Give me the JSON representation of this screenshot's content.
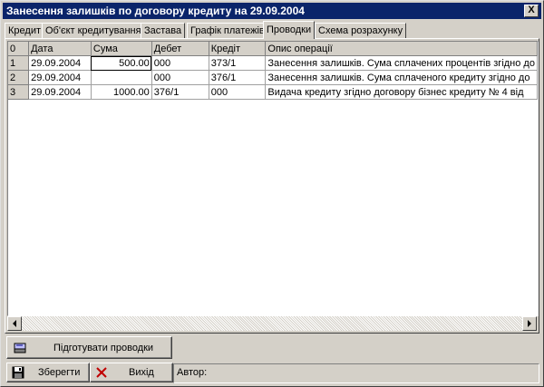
{
  "window": {
    "title": "Занесення залишків по договору кредиту на 29.09.2004",
    "close_label": "X"
  },
  "tabs": [
    "Кредит",
    "Об'єкт кредитування",
    "Застава",
    "Графік платежів",
    "Проводки",
    "Схема розрахунку"
  ],
  "active_tab": "Проводки",
  "grid": {
    "columns": [
      "0",
      "Дата",
      "Сума",
      "Дебет",
      "Кредіт",
      "Опис операції"
    ],
    "rows": [
      [
        "1",
        "29.09.2004",
        "500.00",
        "000",
        "373/1",
        "Занесення залишків. Сума сплачених процентів згідно до"
      ],
      [
        "2",
        "29.09.2004",
        "",
        "000",
        "376/1",
        "Занесення залишків. Сума сплаченого кредиту згідно до"
      ],
      [
        "3",
        "29.09.2004",
        "1000.00",
        "376/1",
        "000",
        "Видача кредиту згідно договору  бізнес кредиту № 4 від"
      ]
    ]
  },
  "prepare_button": {
    "label": "Підготувати проводки",
    "icon": "layers-icon"
  },
  "save_button": {
    "label": "Зберегти",
    "icon": "floppy-disk-icon"
  },
  "exit_button": {
    "label": "Вихід",
    "icon": "red-x-icon"
  },
  "status": {
    "author_label": "Автор:"
  },
  "colors": {
    "titlebar": "#0a246a",
    "face": "#d4d0c8",
    "exit_icon": "#c00000"
  }
}
